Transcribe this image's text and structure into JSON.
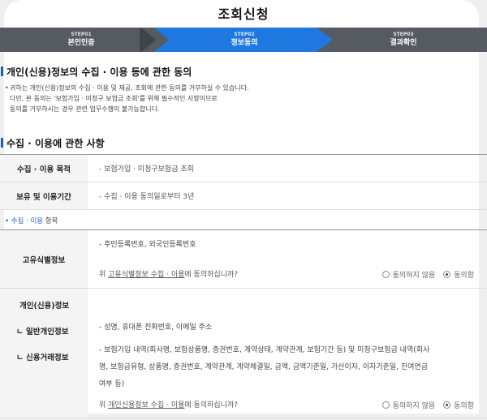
{
  "page_title": "조회신청",
  "steps": [
    {
      "num": "STEP01",
      "label": "본인인증",
      "active": false
    },
    {
      "num": "STEP02",
      "label": "정보동의",
      "active": true
    },
    {
      "num": "STEP03",
      "label": "결과확인",
      "active": false
    }
  ],
  "consent_section": {
    "heading": "개인(신용)정보의 수집 · 이용 등에 관한 동의",
    "bullet": "•",
    "notice_lines": [
      "귀하는 개인(신용)정보의 수집 · 이용 및 제공, 조회에 관한 동의를 거부하실 수 있습니다.",
      "다만, 본 동의는 '보험가입 · 미청구 보험금 조회'를 위해 필수적인 사항이므로",
      "동의를 거부하시는 경우 관련 업무수행이 불가능합니다."
    ]
  },
  "collection_section": {
    "heading": "수집 · 이용에 관한 사항",
    "rows": [
      {
        "label": "수집 · 이용 목적",
        "value": "- 보험가입 · 미청구보험금 조회"
      },
      {
        "label": "보유 및 이용기간",
        "value": "- 수집 · 이용 동의일로부터 3년"
      }
    ]
  },
  "items_section": {
    "title_prefix": "• 수집 · 이용",
    "title_tail": " 항목",
    "unique_info": {
      "label": "고유식별정보",
      "value": "- 주민등록번호, 외국인등록번호",
      "question_prefix": "위 ",
      "question_link": "고유식별정보 수집 · 이용",
      "question_suffix": "에 동의하십니까?",
      "radio_disagree": "동의하지 않음",
      "radio_agree": "동의함",
      "selected": "agree"
    },
    "personal_info": {
      "label": "개인(신용)정보",
      "sub_general": "ㄴ  일반개인정보",
      "sub_credit": "ㄴ  신용거래정보",
      "general_value": "- 성명, 휴대폰 전화번호, 이메일 주소",
      "credit_value_1": "- 보험가입 내역(회사명, 보험상품명, 증권번호, 계약상태, 계약관계, 보험기간 등) 및 미청구보험금 내역(회사",
      "credit_value_2": "명, 보험금유형, 상품명, 증권번호, 계약관계, 계약체결일, 금액, 금액기준일, 가산이자, 이자기준일, 진여연금",
      "credit_value_3": "여부 등)",
      "question_prefix": "위 ",
      "question_link": "개인신용정보 수집 · 이용",
      "question_suffix": "에 동의하십니까?",
      "radio_disagree": "동의하지 않음",
      "radio_agree": "동의함",
      "selected": "agree"
    }
  }
}
